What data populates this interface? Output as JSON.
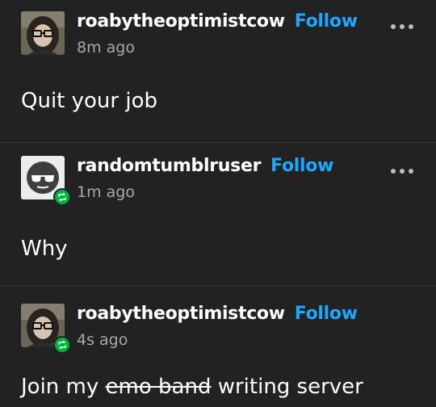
{
  "posts": [
    {
      "username": "roabytheoptimistcow",
      "follow_label": "Follow",
      "timestamp": "8m ago",
      "avatar_icon": "person-with-glasses-avatar",
      "body": "Quit your job"
    },
    {
      "username": "randomtumblruser",
      "follow_label": "Follow",
      "timestamp": "1m ago",
      "avatar_icon": "sunglasses-face-avatar",
      "reblog_icon": "reblog-icon",
      "body": "Why"
    },
    {
      "username": "roabytheoptimistcow",
      "follow_label": "Follow",
      "timestamp": "4s ago",
      "avatar_icon": "person-with-glasses-avatar",
      "reblog_icon": "reblog-icon",
      "body_before": "Join my ",
      "body_struck": "emo band",
      "body_after": " writing server"
    }
  ],
  "colors": {
    "background": "#222222",
    "follow": "#1ea7ff",
    "timestamp": "#a8a8a8",
    "reblog_badge": "#00b33c"
  }
}
